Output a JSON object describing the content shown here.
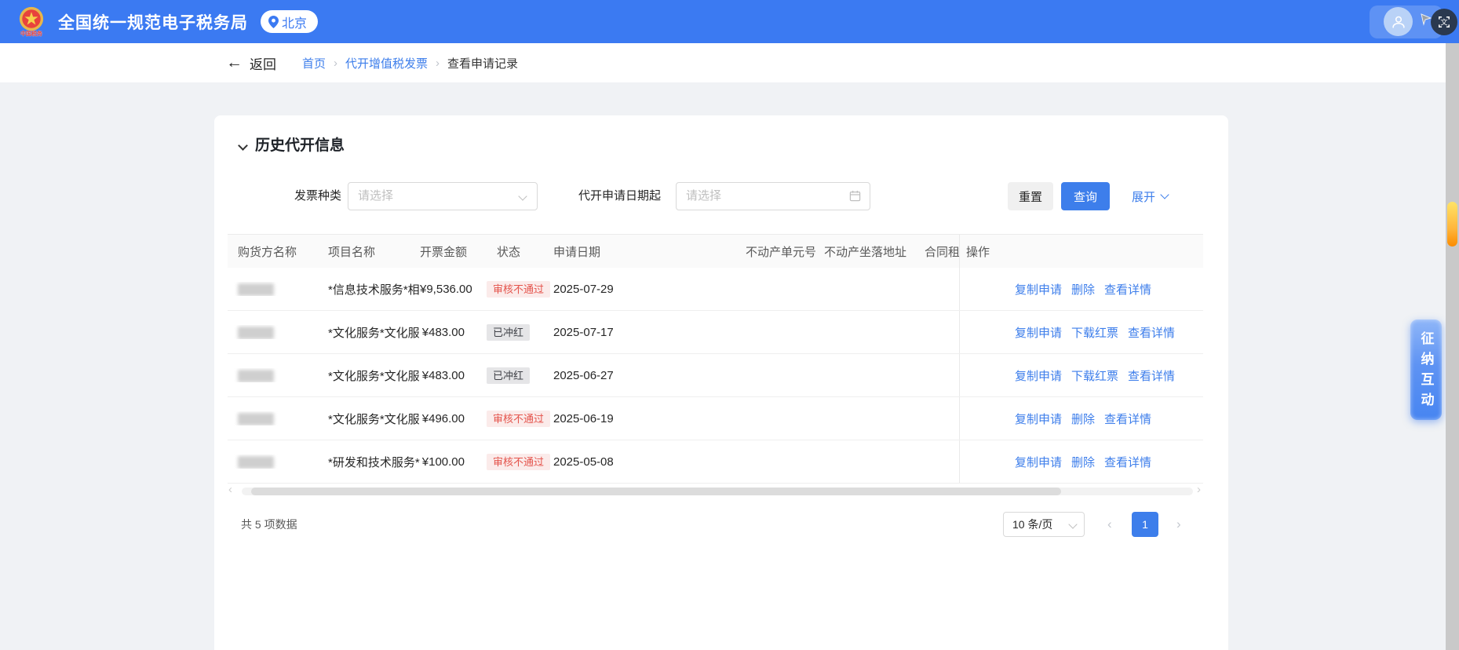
{
  "header": {
    "title": "全国统一规范电子税务局",
    "location": "北京",
    "colors": {
      "bar_bg": "#3B7AF2",
      "accent": "#3D7EEB"
    }
  },
  "nav": {
    "back_label": "返回",
    "back_arrow_glyph": "←",
    "separator_glyph": "›",
    "breadcrumbs": [
      {
        "label": "首页",
        "link": true
      },
      {
        "label": "代开增值税发票",
        "link": true
      },
      {
        "label": "查看申请记录",
        "link": false
      }
    ]
  },
  "panel": {
    "section_title": "历史代开信息",
    "filters": {
      "invoice_type_label": "发票种类",
      "invoice_type_placeholder": "请选择",
      "date_from_label": "代开申请日期起",
      "date_from_placeholder": "请选择",
      "reset_label": "重置",
      "search_label": "查询",
      "expand_label": "展开"
    },
    "table": {
      "columns": [
        "购货方名称",
        "项目名称",
        "开票金额",
        "状态",
        "申请日期",
        "不动产单元号",
        "不动产坐落地址",
        "合同租赁",
        "操作"
      ],
      "status_colors": {
        "error": {
          "bg": "#FBEBEA",
          "text": "#E4534B"
        },
        "neutral": {
          "bg": "#E5E5E7",
          "text": "#404248"
        }
      },
      "rows": [
        {
          "buyer_redacted": true,
          "project": "*信息技术服务*相...",
          "amount": "¥9,536.00",
          "status": "审核不通过",
          "status_type": "error",
          "date": "2025-07-29",
          "actions": [
            "复制申请",
            "删除",
            "查看详情"
          ]
        },
        {
          "buyer_redacted": true,
          "project": "*文化服务*文化服...",
          "amount": "¥483.00",
          "status": "已冲红",
          "status_type": "neutral",
          "date": "2025-07-17",
          "actions": [
            "复制申请",
            "下载红票",
            "查看详情"
          ]
        },
        {
          "buyer_redacted": true,
          "project": "*文化服务*文化服...",
          "amount": "¥483.00",
          "status": "已冲红",
          "status_type": "neutral",
          "date": "2025-06-27",
          "actions": [
            "复制申请",
            "下载红票",
            "查看详情"
          ]
        },
        {
          "buyer_redacted": true,
          "project": "*文化服务*文化服...",
          "amount": "¥496.00",
          "status": "审核不通过",
          "status_type": "error",
          "date": "2025-06-19",
          "actions": [
            "复制申请",
            "删除",
            "查看详情"
          ]
        },
        {
          "buyer_redacted": true,
          "project": "*研发和技术服务*...",
          "amount": "¥100.00",
          "status": "审核不通过",
          "status_type": "error",
          "date": "2025-05-08",
          "actions": [
            "复制申请",
            "删除",
            "查看详情"
          ]
        }
      ]
    },
    "pagination": {
      "total_text": "共 5 项数据",
      "page_size": "10 条/页",
      "current_page": "1",
      "prev_glyph": "‹",
      "next_glyph": "›"
    }
  },
  "floating": {
    "interaction_button": "征纳互动"
  }
}
